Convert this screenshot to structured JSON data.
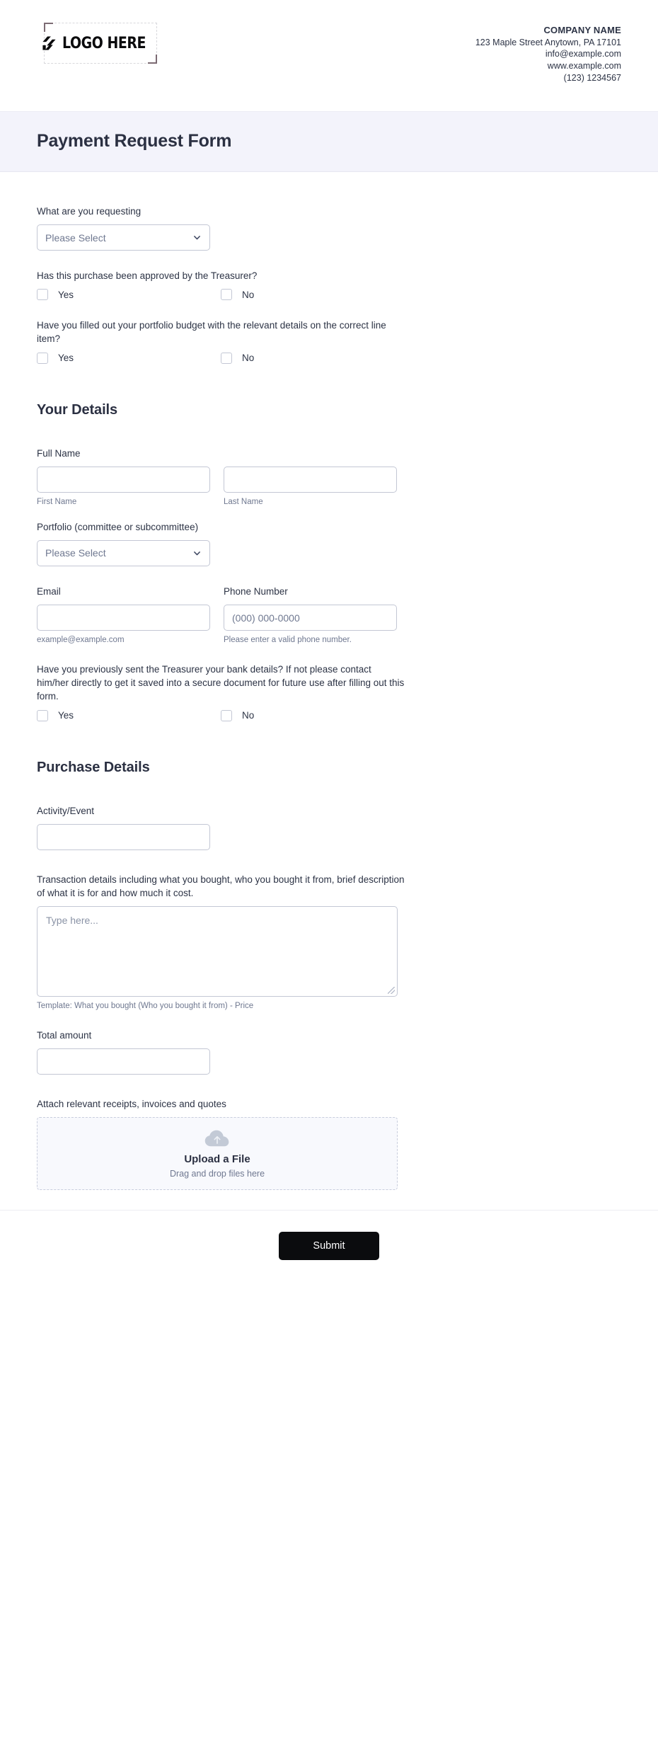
{
  "letterhead": {
    "logo_placeholder": "LOGO HERE",
    "logo_icon": "stacked-slashes-logo-icon",
    "company_name": "COMPANY NAME",
    "address": "123 Maple Street Anytown, PA 17101",
    "email": "info@example.com",
    "website": "www.example.com",
    "phone": "(123) 1234567"
  },
  "header": {
    "title": "Payment Request Form",
    "band_color": "#f3f3fb"
  },
  "intro": {
    "requesting_label": "What are you requesting",
    "requesting_value": "Please Select",
    "approved_question": "Has this purchase been approved by the Treasurer?",
    "approved_yes": "Yes",
    "approved_no": "No",
    "portfolio_budget_question": "Have you filled out your portfolio budget with the relevant details on the correct line item?",
    "portfolio_budget_yes": "Yes",
    "portfolio_budget_no": "No"
  },
  "your_details": {
    "heading": "Your Details",
    "full_name_label": "Full Name",
    "first_name_sublabel": "First Name",
    "last_name_sublabel": "Last Name",
    "first_name_value": "",
    "last_name_value": "",
    "portfolio_label": "Portfolio (committee or subcommittee)",
    "portfolio_value": "Please Select",
    "email_label": "Email",
    "email_value": "",
    "email_sublabel": "example@example.com",
    "phone_label": "Phone Number",
    "phone_placeholder": "(000) 000-0000",
    "phone_sublabel": "Please enter a valid phone number.",
    "bank_details_question": "Have you previously sent the Treasurer your bank details? If not please contact him/her directly to get it saved into a secure document for future use after filling out this form.",
    "bank_details_yes": "Yes",
    "bank_details_no": "No"
  },
  "purchase_details": {
    "heading": "Purchase Details",
    "activity_label": "Activity/Event",
    "activity_value": "",
    "transaction_label": "Transaction details including what you bought, who you bought it from, brief description of what it is for and how much it cost.",
    "transaction_placeholder": "Type here...",
    "transaction_sublabel": "Template: What you bought (Who you bought it from) - Price",
    "total_amount_label": "Total amount",
    "total_amount_value": "",
    "attach_label": "Attach relevant receipts, invoices and quotes",
    "upload_icon": "cloud-upload-icon",
    "upload_title": "Upload a File",
    "upload_sub": "Drag and drop files here"
  },
  "footer": {
    "submit_label": "Submit",
    "submit_color": "#0b0c0e"
  },
  "icons": {
    "chevron_down": "chevron-down-icon"
  }
}
